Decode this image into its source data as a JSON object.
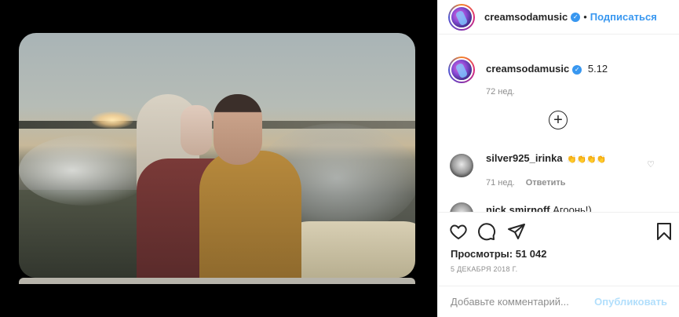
{
  "header": {
    "username": "creamsodamusic",
    "separator": "•",
    "follow_label": "Подписаться"
  },
  "caption": {
    "username": "creamsodamusic",
    "text": "5.12",
    "age": "72 нед."
  },
  "comments": [
    {
      "username": "silver925_irinka",
      "text": "👏👏👏👏",
      "age": "71 нед.",
      "reply_label": "Ответить"
    },
    {
      "username": "nick.smirnoff",
      "text": "Агоонь!)"
    }
  ],
  "stats": {
    "views": "Просмотры: 51 042",
    "date": "5 ДЕКАБРЯ 2018 Г."
  },
  "composer": {
    "placeholder": "Добавьте комментарий...",
    "publish_label": "Опубликовать"
  },
  "icons": [
    "verified-icon",
    "more-comments-icon",
    "like-icon",
    "comment-icon",
    "share-icon",
    "save-icon",
    "comment-like-icon"
  ],
  "colors": {
    "accent": "#3897f0",
    "publish_disabled": "#b2dffc",
    "muted": "#8e8e8e"
  }
}
